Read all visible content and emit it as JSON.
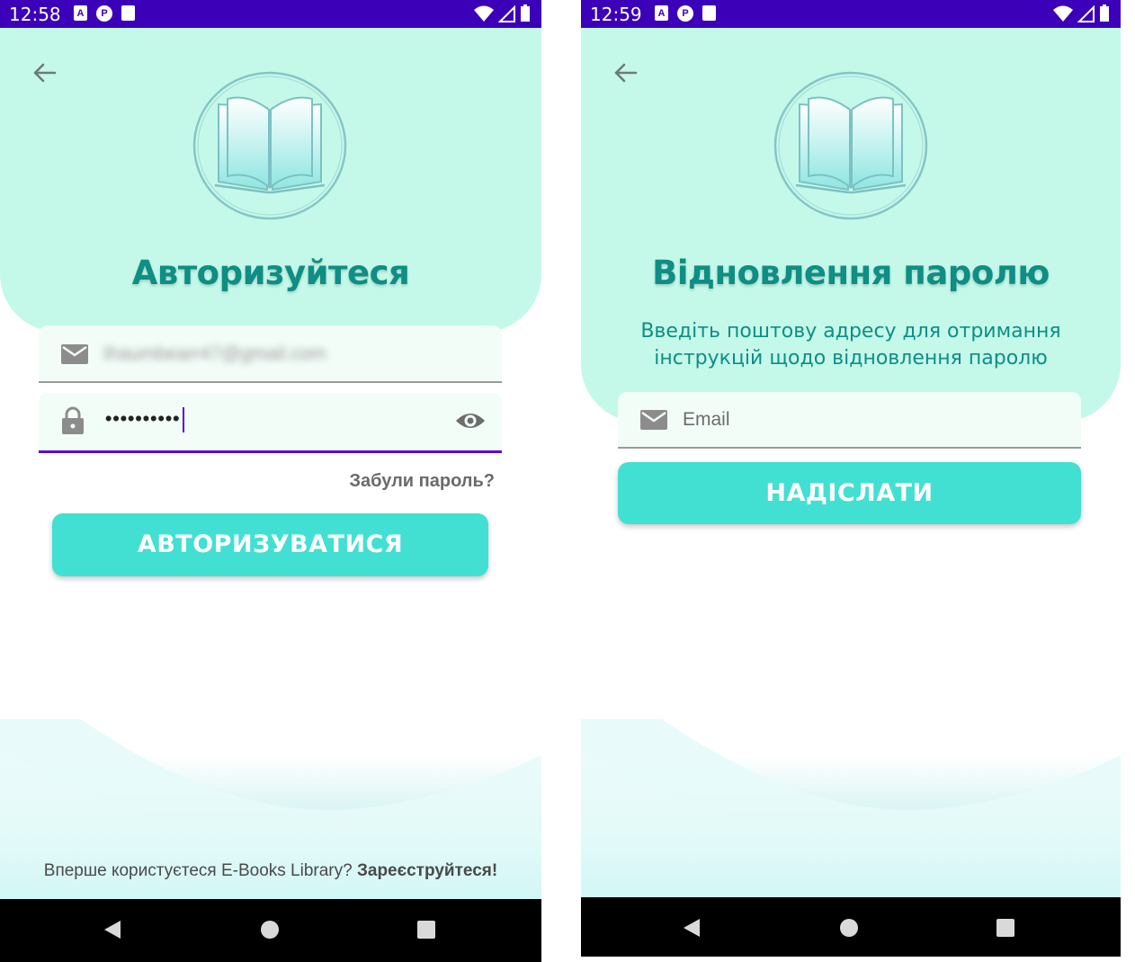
{
  "screens": {
    "login": {
      "status_time": "12:58",
      "title": "Авторизуйтеся",
      "email_value": "thaumbearr47@gmail.com",
      "password_value": "••••••••••",
      "forgot_password": "Забули пароль?",
      "login_button": "АВТОРИЗУВАТИСЯ",
      "footer_text": "Вперше користуєтеся E-Books Library? ",
      "footer_link": "Зареєструйтеся!"
    },
    "recovery": {
      "status_time": "12:59",
      "title": "Відновлення паролю",
      "subtitle": "Введіть поштову адресу для отримання інструкцій щодо відновлення паролю",
      "email_placeholder": "Email",
      "send_button": "НАДІСЛАТИ"
    }
  },
  "colors": {
    "status_bar": "#3b00b8",
    "header": "#c4f9ea",
    "title": "#0e8e84",
    "button": "#41e0d3",
    "focus_underline": "#5b00d9"
  },
  "icons": {
    "back": "arrow-left-icon",
    "email": "mail-icon",
    "password": "lock-icon",
    "toggle_visibility": "eye-icon",
    "logo": "book-icon"
  }
}
